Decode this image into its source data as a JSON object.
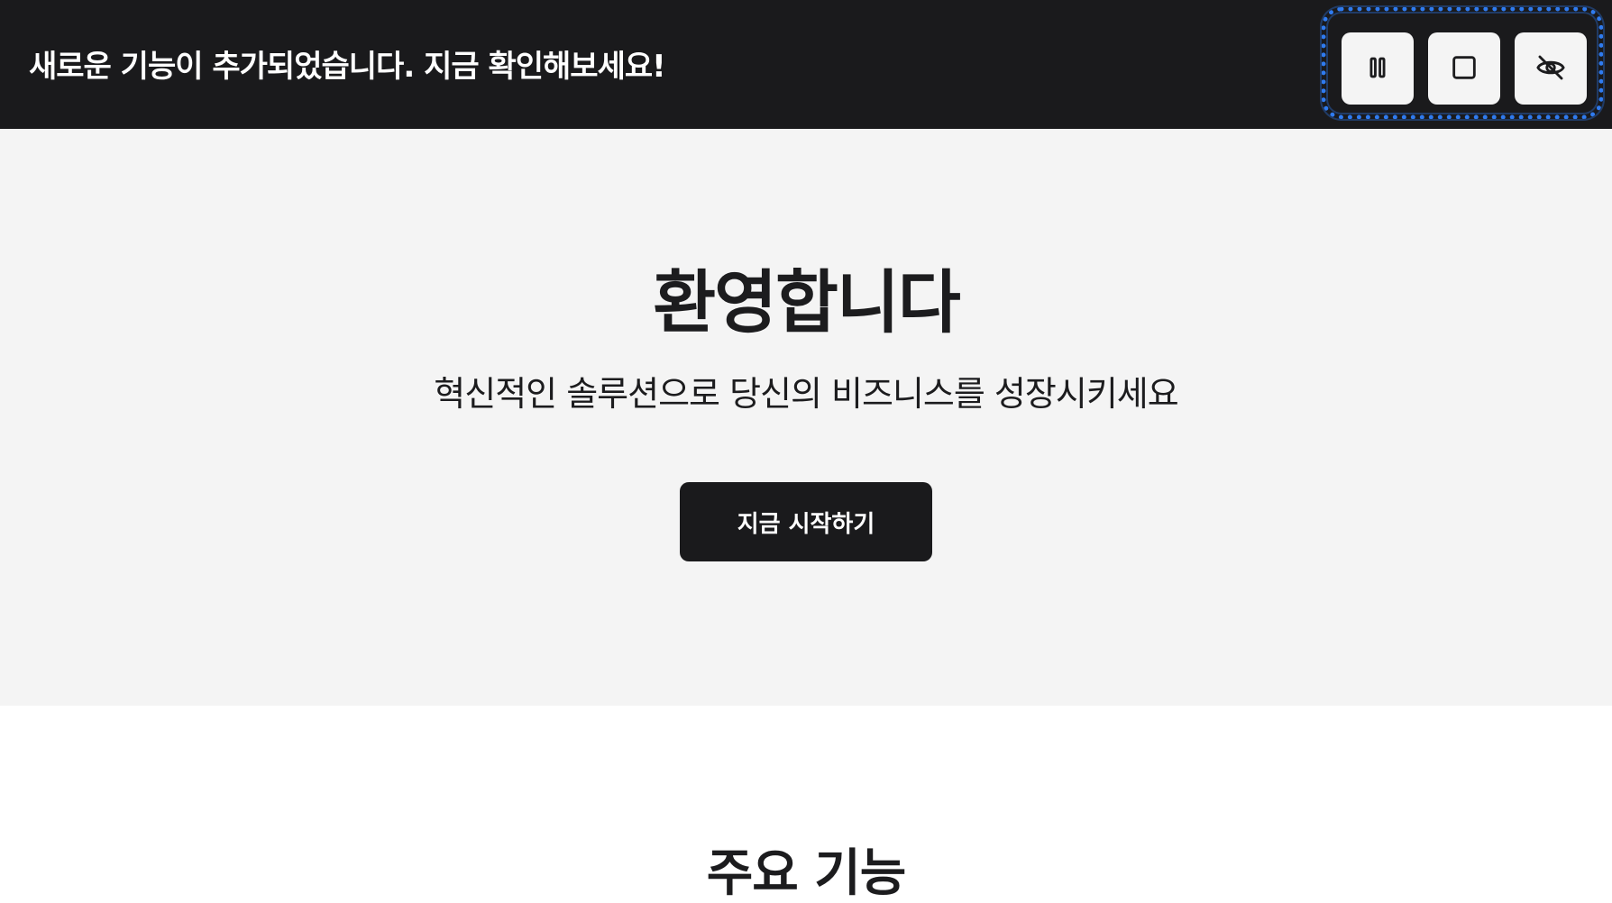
{
  "banner": {
    "message": "새로운 기능이 추가되었습니다. 지금 확인해보세요!",
    "controls": [
      {
        "name": "pause",
        "icon": "pause-icon"
      },
      {
        "name": "stop",
        "icon": "square-icon"
      },
      {
        "name": "hide",
        "icon": "eye-off-icon"
      }
    ],
    "highlight_color": "#2f7bf0",
    "background_color": "#1a1a1c"
  },
  "hero": {
    "title": "환영합니다",
    "subtitle": "혁신적인 솔루션으로 당신의 비즈니스를 성장시키세요",
    "cta_label": "지금 시작하기",
    "background_color": "#f4f4f4"
  },
  "features": {
    "title": "주요 기능"
  }
}
